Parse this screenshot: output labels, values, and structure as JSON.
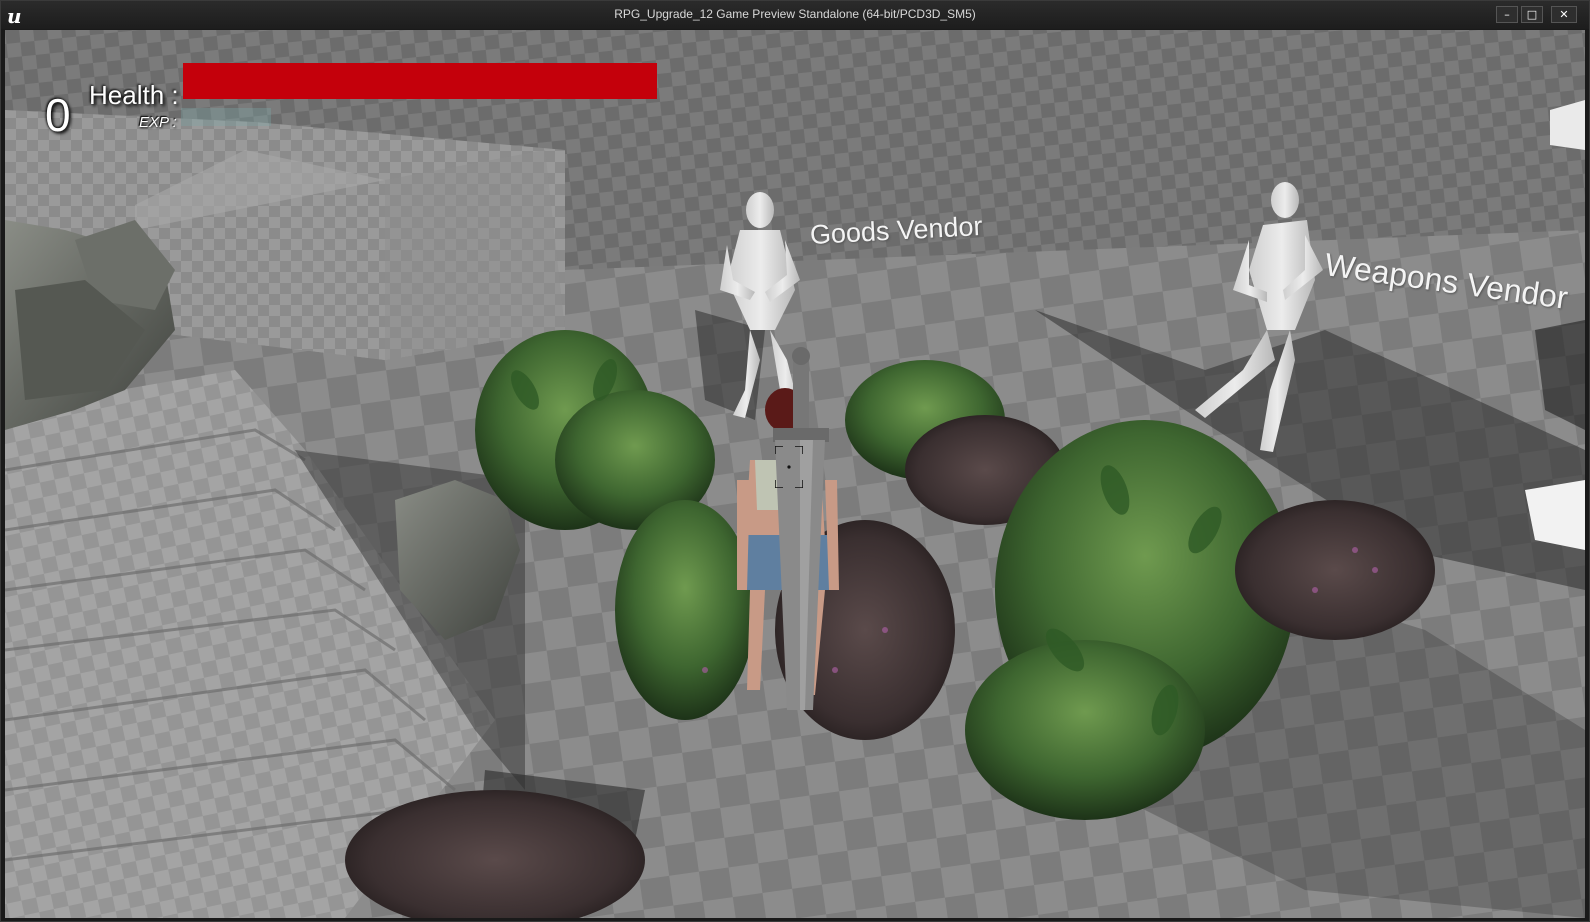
{
  "window": {
    "title": "RPG_Upgrade_12 Game Preview Standalone (64-bit/PCD3D_SM5)",
    "logo_glyph": "u",
    "minimize_glyph": "–",
    "maximize_glyph": "□",
    "close_glyph": "✕"
  },
  "hud": {
    "level_value": "0",
    "health_label": "Health :",
    "health_fraction": 1.0,
    "health_color": "#c4000b",
    "exp_label": "EXP :"
  },
  "world": {
    "goods_vendor_label": "Goods Vendor",
    "weapons_vendor_label": "Weapons Vendor"
  },
  "icons": {
    "crosshair": "crosshair-icon"
  }
}
